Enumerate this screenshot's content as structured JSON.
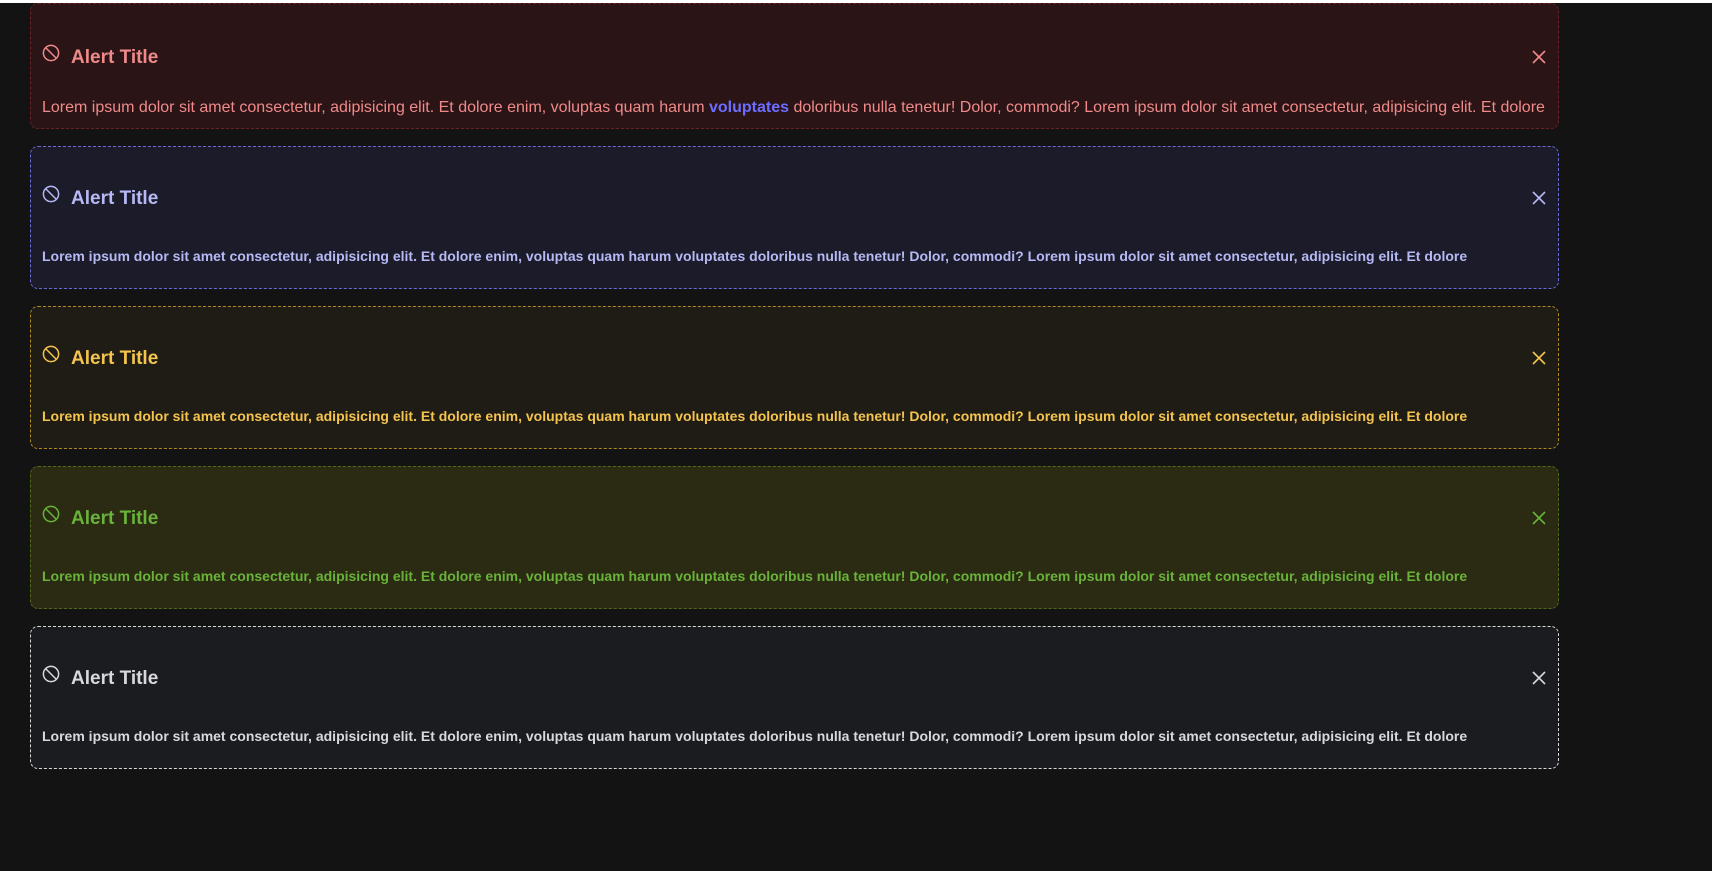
{
  "alerts": [
    {
      "variant": "error",
      "title": "Alert Title",
      "body_before": "Lorem ipsum dolor sit amet consectetur, adipisicing elit. Et dolore enim, voluptas quam harum ",
      "body_link": "voluptates",
      "body_after": " doloribus nulla tenetur! Dolor, commodi? Lorem ipsum dolor sit amet consectetur, adipisicing elit. Et dolore",
      "icon": "ban-icon",
      "close_icon": "close-icon",
      "colors": {
        "bg": "#2a1416",
        "border": "#6b2127",
        "text": "#f08a8a",
        "link": "#6d6dff"
      }
    },
    {
      "variant": "info",
      "title": "Alert Title",
      "body": "Lorem ipsum dolor sit amet consectetur, adipisicing elit. Et dolore enim, voluptas quam harum voluptates doloribus nulla tenetur! Dolor, commodi? Lorem ipsum dolor sit amet consectetur, adipisicing elit. Et dolore",
      "icon": "ban-icon",
      "close_icon": "close-icon",
      "colors": {
        "bg": "#1b1b2a",
        "border": "#6b6bd8",
        "text": "#b7b9f5"
      }
    },
    {
      "variant": "warning",
      "title": "Alert Title",
      "body": "Lorem ipsum dolor sit amet consectetur, adipisicing elit. Et dolore enim, voluptas quam harum voluptates doloribus nulla tenetur! Dolor, commodi? Lorem ipsum dolor sit amet consectetur, adipisicing elit. Et dolore",
      "icon": "ban-icon",
      "close_icon": "close-icon",
      "colors": {
        "bg": "#1f1b15",
        "border": "#b08a21",
        "text": "#f4c44e"
      }
    },
    {
      "variant": "success",
      "title": "Alert Title",
      "body": "Lorem ipsum dolor sit amet consectetur, adipisicing elit. Et dolore enim, voluptas quam harum voluptates doloribus nulla tenetur! Dolor, commodi? Lorem ipsum dolor sit amet consectetur, adipisicing elit. Et dolore",
      "icon": "ban-icon",
      "close_icon": "close-icon",
      "colors": {
        "bg": "#2b2a13",
        "border": "#4e6a1a",
        "text": "#69b33a"
      }
    },
    {
      "variant": "neutral",
      "title": "Alert Title",
      "body": "Lorem ipsum dolor sit amet consectetur, adipisicing elit. Et dolore enim, voluptas quam harum voluptates doloribus nulla tenetur! Dolor, commodi? Lorem ipsum dolor sit amet consectetur, adipisicing elit. Et dolore",
      "icon": "ban-icon",
      "close_icon": "close-icon",
      "colors": {
        "bg": "#1b1c20",
        "border": "#d8d8d8",
        "text": "#d9d9dc"
      }
    }
  ],
  "page": {
    "background": "#131314",
    "top_strip": "#ffffff"
  }
}
